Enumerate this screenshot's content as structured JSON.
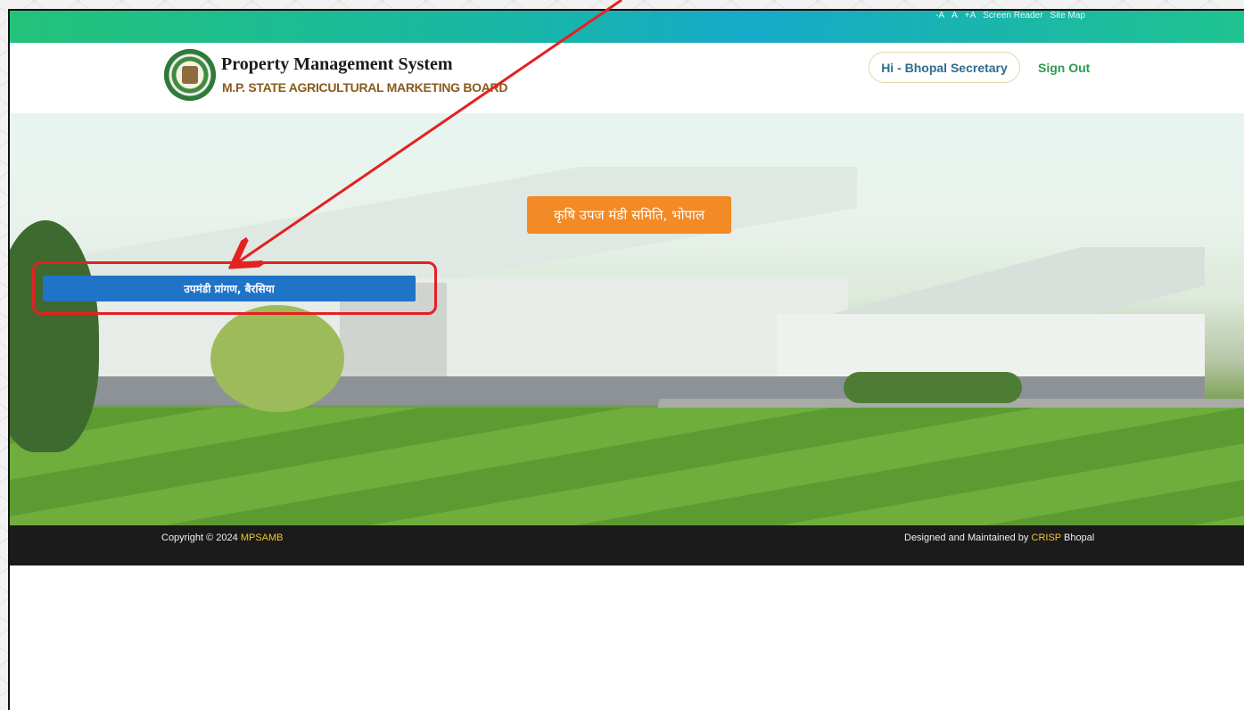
{
  "topbar": {
    "links": [
      "-A",
      "A",
      "+A",
      "Screen Reader",
      "Site Map"
    ]
  },
  "brand": {
    "title": "Property Management System",
    "subtitle": "M.P. STATE AGRICULTURAL MARKETING BOARD"
  },
  "user": {
    "greeting": "Hi - Bhopal Secretary",
    "sign_out": "Sign Out"
  },
  "hero": {
    "title": "कृषि उपज मंडी समिति, भोपाल",
    "sub_mandi_button": "उपमंडी प्रांगण, बैरसिया"
  },
  "footer": {
    "copyright_prefix": "Copyright © 2024",
    "copyright_org": "MPSAMB",
    "designed_prefix": "Designed and Maintained by",
    "designed_org": "CRISP",
    "designed_suffix": "Bhopal"
  },
  "colors": {
    "topbar_green": "#22c27a",
    "topbar_teal": "#16a9c9",
    "hero_badge": "#f28a25",
    "action_blue": "#1f74c8",
    "annotation_red": "#e32121",
    "footer_bg": "#1b1b1b",
    "footer_accent": "#f2c62b"
  }
}
